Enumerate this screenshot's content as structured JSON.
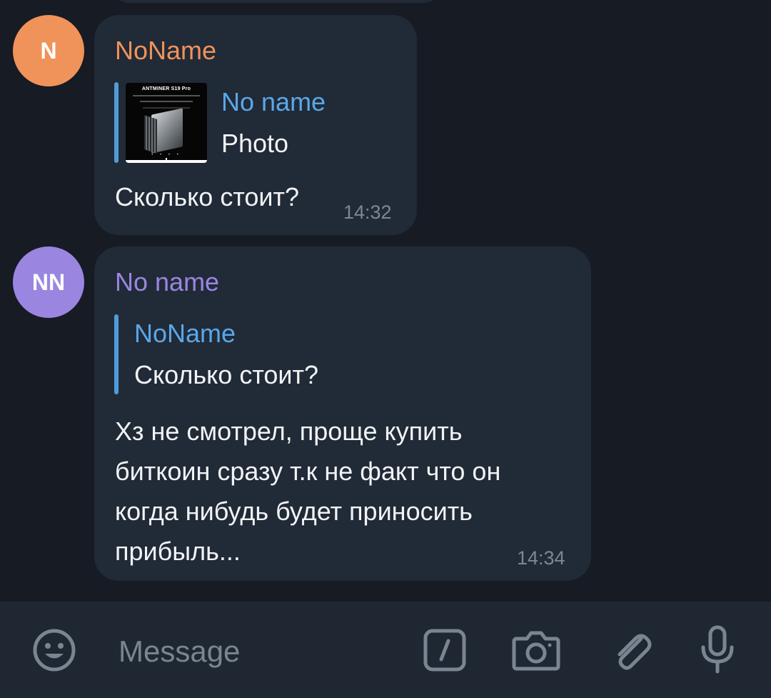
{
  "messages": [
    {
      "avatar_initials": "N",
      "avatar_color": "#f0935a",
      "sender": "NoName",
      "sender_color": "#f0935a",
      "reply": {
        "title": "No name",
        "text": "Photo",
        "thumbnail_text": "ANTMINER S19 Pro"
      },
      "text": "Сколько стоит?",
      "time": "14:32"
    },
    {
      "avatar_initials": "NN",
      "avatar_color": "#9a86e0",
      "sender": "No name",
      "sender_color": "#9a86e0",
      "reply": {
        "title": "NoName",
        "text": "Сколько стоит?"
      },
      "text_lines": [
        "Хз не смотрел, проще купить",
        "биткоин сразу т.к не факт что он",
        "когда нибудь будет приносить",
        "прибыль..."
      ],
      "time": "14:34"
    }
  ],
  "input_bar": {
    "placeholder": "Message",
    "icons": [
      "emoji-icon",
      "bot-command-icon",
      "camera-icon",
      "attach-icon",
      "microphone-icon"
    ]
  },
  "colors": {
    "background": "#161b24",
    "bubble": "#212a37",
    "accent_blue": "#5aa8e8",
    "input_bar": "#1f2732"
  }
}
